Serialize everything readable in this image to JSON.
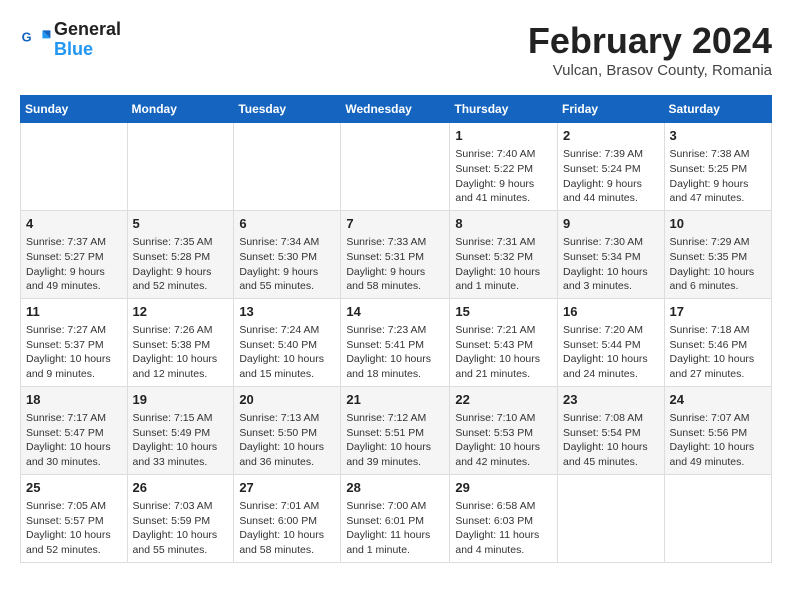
{
  "header": {
    "title": "February 2024",
    "location": "Vulcan, Brasov County, Romania",
    "logo_line1": "General",
    "logo_line2": "Blue"
  },
  "days_of_week": [
    "Sunday",
    "Monday",
    "Tuesday",
    "Wednesday",
    "Thursday",
    "Friday",
    "Saturday"
  ],
  "weeks": [
    [
      {
        "day": "",
        "content": ""
      },
      {
        "day": "",
        "content": ""
      },
      {
        "day": "",
        "content": ""
      },
      {
        "day": "",
        "content": ""
      },
      {
        "day": "1",
        "content": "Sunrise: 7:40 AM\nSunset: 5:22 PM\nDaylight: 9 hours and 41 minutes."
      },
      {
        "day": "2",
        "content": "Sunrise: 7:39 AM\nSunset: 5:24 PM\nDaylight: 9 hours and 44 minutes."
      },
      {
        "day": "3",
        "content": "Sunrise: 7:38 AM\nSunset: 5:25 PM\nDaylight: 9 hours and 47 minutes."
      }
    ],
    [
      {
        "day": "4",
        "content": "Sunrise: 7:37 AM\nSunset: 5:27 PM\nDaylight: 9 hours and 49 minutes."
      },
      {
        "day": "5",
        "content": "Sunrise: 7:35 AM\nSunset: 5:28 PM\nDaylight: 9 hours and 52 minutes."
      },
      {
        "day": "6",
        "content": "Sunrise: 7:34 AM\nSunset: 5:30 PM\nDaylight: 9 hours and 55 minutes."
      },
      {
        "day": "7",
        "content": "Sunrise: 7:33 AM\nSunset: 5:31 PM\nDaylight: 9 hours and 58 minutes."
      },
      {
        "day": "8",
        "content": "Sunrise: 7:31 AM\nSunset: 5:32 PM\nDaylight: 10 hours and 1 minute."
      },
      {
        "day": "9",
        "content": "Sunrise: 7:30 AM\nSunset: 5:34 PM\nDaylight: 10 hours and 3 minutes."
      },
      {
        "day": "10",
        "content": "Sunrise: 7:29 AM\nSunset: 5:35 PM\nDaylight: 10 hours and 6 minutes."
      }
    ],
    [
      {
        "day": "11",
        "content": "Sunrise: 7:27 AM\nSunset: 5:37 PM\nDaylight: 10 hours and 9 minutes."
      },
      {
        "day": "12",
        "content": "Sunrise: 7:26 AM\nSunset: 5:38 PM\nDaylight: 10 hours and 12 minutes."
      },
      {
        "day": "13",
        "content": "Sunrise: 7:24 AM\nSunset: 5:40 PM\nDaylight: 10 hours and 15 minutes."
      },
      {
        "day": "14",
        "content": "Sunrise: 7:23 AM\nSunset: 5:41 PM\nDaylight: 10 hours and 18 minutes."
      },
      {
        "day": "15",
        "content": "Sunrise: 7:21 AM\nSunset: 5:43 PM\nDaylight: 10 hours and 21 minutes."
      },
      {
        "day": "16",
        "content": "Sunrise: 7:20 AM\nSunset: 5:44 PM\nDaylight: 10 hours and 24 minutes."
      },
      {
        "day": "17",
        "content": "Sunrise: 7:18 AM\nSunset: 5:46 PM\nDaylight: 10 hours and 27 minutes."
      }
    ],
    [
      {
        "day": "18",
        "content": "Sunrise: 7:17 AM\nSunset: 5:47 PM\nDaylight: 10 hours and 30 minutes."
      },
      {
        "day": "19",
        "content": "Sunrise: 7:15 AM\nSunset: 5:49 PM\nDaylight: 10 hours and 33 minutes."
      },
      {
        "day": "20",
        "content": "Sunrise: 7:13 AM\nSunset: 5:50 PM\nDaylight: 10 hours and 36 minutes."
      },
      {
        "day": "21",
        "content": "Sunrise: 7:12 AM\nSunset: 5:51 PM\nDaylight: 10 hours and 39 minutes."
      },
      {
        "day": "22",
        "content": "Sunrise: 7:10 AM\nSunset: 5:53 PM\nDaylight: 10 hours and 42 minutes."
      },
      {
        "day": "23",
        "content": "Sunrise: 7:08 AM\nSunset: 5:54 PM\nDaylight: 10 hours and 45 minutes."
      },
      {
        "day": "24",
        "content": "Sunrise: 7:07 AM\nSunset: 5:56 PM\nDaylight: 10 hours and 49 minutes."
      }
    ],
    [
      {
        "day": "25",
        "content": "Sunrise: 7:05 AM\nSunset: 5:57 PM\nDaylight: 10 hours and 52 minutes."
      },
      {
        "day": "26",
        "content": "Sunrise: 7:03 AM\nSunset: 5:59 PM\nDaylight: 10 hours and 55 minutes."
      },
      {
        "day": "27",
        "content": "Sunrise: 7:01 AM\nSunset: 6:00 PM\nDaylight: 10 hours and 58 minutes."
      },
      {
        "day": "28",
        "content": "Sunrise: 7:00 AM\nSunset: 6:01 PM\nDaylight: 11 hours and 1 minute."
      },
      {
        "day": "29",
        "content": "Sunrise: 6:58 AM\nSunset: 6:03 PM\nDaylight: 11 hours and 4 minutes."
      },
      {
        "day": "",
        "content": ""
      },
      {
        "day": "",
        "content": ""
      }
    ]
  ]
}
